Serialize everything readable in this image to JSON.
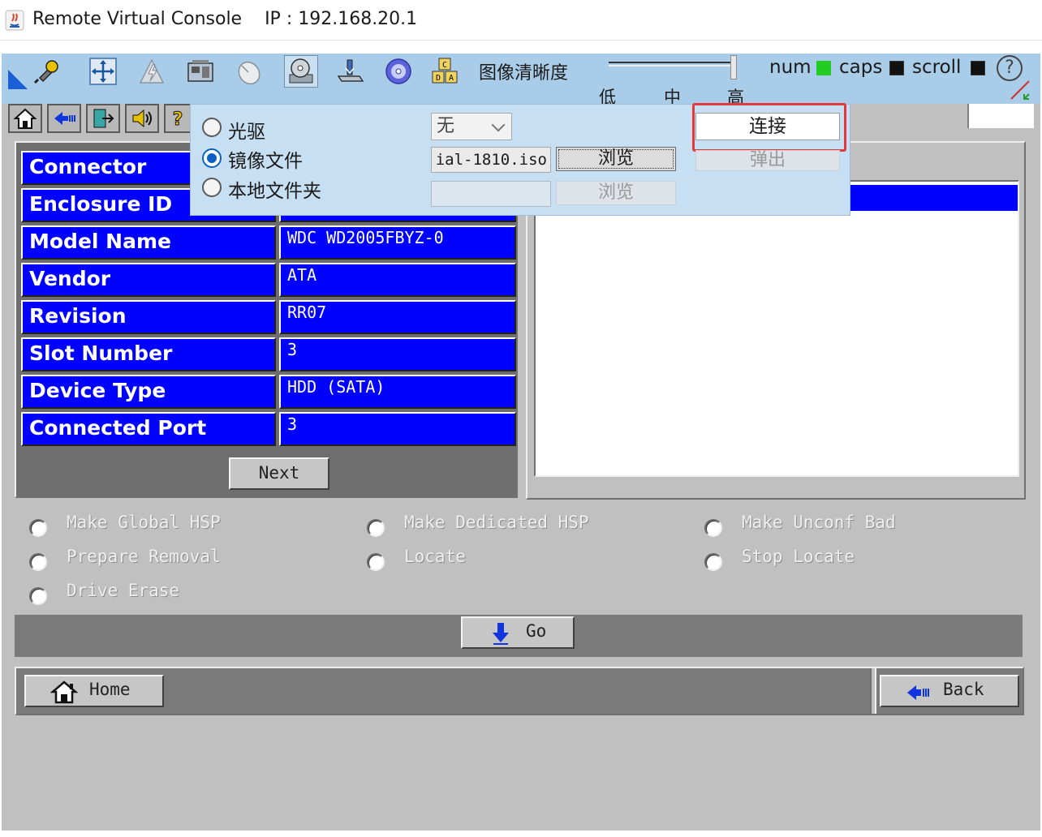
{
  "window": {
    "title": "Remote Virtual Console    IP : 192.168.20.1"
  },
  "toolbar": {
    "icons": [
      "connect-plug-icon",
      "move-arrows-icon",
      "power-icon",
      "network-icon",
      "mouse-icon",
      "virtual-media-disk-icon",
      "usb-drive-icon",
      "cd-rom-icon",
      "keyboard-layout-icon"
    ],
    "clarity_label": "图像清晰度",
    "clarity_ticks": [
      "低",
      "中",
      "高"
    ],
    "clarity_level": "高",
    "lock_keys": [
      {
        "label": "num",
        "state": "on",
        "color": "#22cc22"
      },
      {
        "label": "caps",
        "state": "off",
        "color": "#111111"
      },
      {
        "label": "scroll",
        "state": "off",
        "color": "#111111"
      }
    ],
    "help_label": "?"
  },
  "console_toolbar": {
    "icons": [
      "home-icon",
      "back-arrow-icon",
      "exit-icon",
      "sound-icon",
      "question-icon"
    ]
  },
  "virtual_media_popup": {
    "options": [
      {
        "label": "光驱",
        "selected": false
      },
      {
        "label": "镜像文件",
        "selected": true
      },
      {
        "label": "本地文件夹",
        "selected": false
      }
    ],
    "drive_select_value": "无",
    "iso_path_value": "ial-1810.iso",
    "browse_label": "浏览",
    "browse_folder_label": "浏览",
    "connect_label": "连接",
    "eject_label": "弹出",
    "highlight_color": "#e03a3a"
  },
  "properties": {
    "rows": [
      {
        "label": "Connector",
        "value": ""
      },
      {
        "label": "Enclosure ID",
        "value": ""
      },
      {
        "label": "Model Name",
        "value": "WDC WD2005FBYZ-0"
      },
      {
        "label": "Vendor",
        "value": "ATA"
      },
      {
        "label": "Revision",
        "value": "RR07"
      },
      {
        "label": "Slot Number",
        "value": "3"
      },
      {
        "label": "Device Type",
        "value": "HDD (SATA)"
      },
      {
        "label": "Connected Port",
        "value": "3"
      }
    ],
    "next_label": "Next"
  },
  "actions": {
    "options": [
      {
        "label": "Make Global HSP"
      },
      {
        "label": "Make Dedicated HSP"
      },
      {
        "label": "Make Unconf Bad"
      },
      {
        "label": "Prepare Removal"
      },
      {
        "label": "Locate"
      },
      {
        "label": "Stop Locate"
      },
      {
        "label": "Drive Erase"
      }
    ],
    "go_label": "Go"
  },
  "nav": {
    "home_label": "Home",
    "back_label": "Back"
  },
  "colors": {
    "toolbar_bg": "#a9cde8",
    "console_bg": "#c0c0c0",
    "cell_blue": "#0000ff"
  }
}
